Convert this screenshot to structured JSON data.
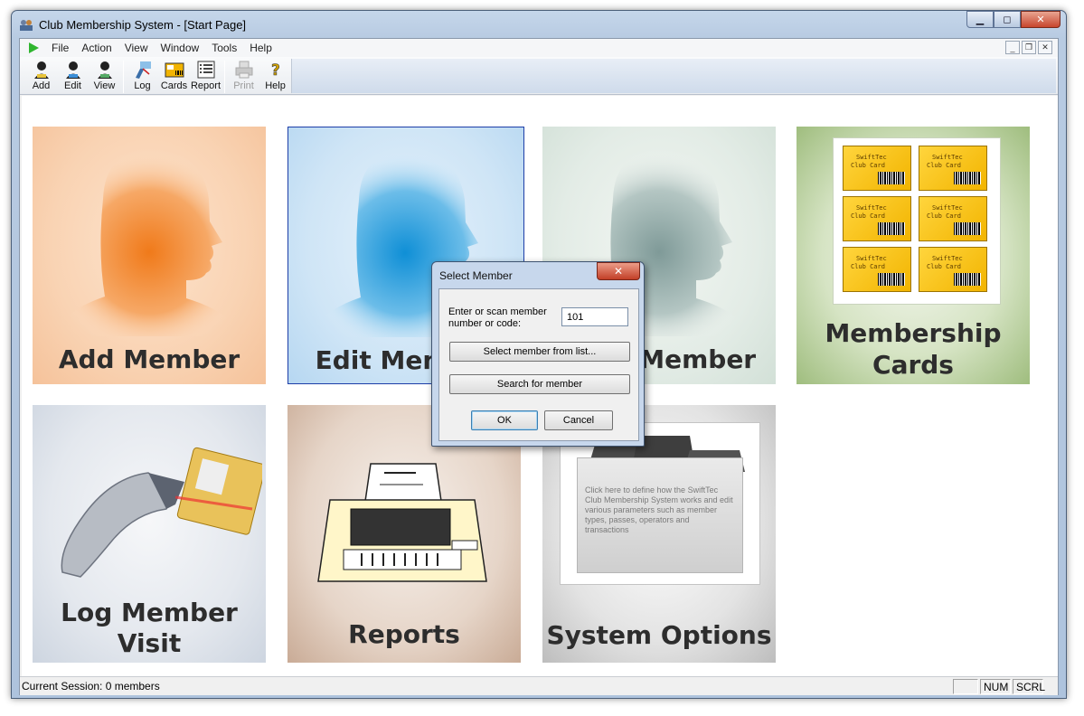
{
  "window": {
    "title": "Club Membership System - [Start Page]",
    "controls": {
      "minimize": "▁",
      "maximize": "◻",
      "close": "✕"
    }
  },
  "menu": {
    "items": [
      "File",
      "Action",
      "View",
      "Window",
      "Tools",
      "Help"
    ],
    "mdi_controls": {
      "minimize": "_",
      "restore": "❐",
      "close": "✕"
    }
  },
  "toolbar": {
    "add": "Add",
    "edit": "Edit",
    "view": "View",
    "log": "Log",
    "cards": "Cards",
    "report": "Report",
    "print": "Print",
    "help": "Help"
  },
  "tiles": {
    "add_member": "Add Member",
    "edit_member": "Edit Member",
    "view_member": "View Member",
    "cards_line1": "Membership",
    "cards_line2": "Cards",
    "card_text_1": "SwiftTec",
    "card_text_2": "Club Card",
    "log_line1": "Log Member",
    "log_line2": "Visit",
    "reports": "Reports",
    "system_options": "System Options",
    "options_desc": "Click here to define how the SwiftTec Club Membership System works and edit various parameters such as member types, passes, operators and transactions"
  },
  "dialog": {
    "title": "Select Member",
    "close": "✕",
    "prompt": "Enter or scan member number or code:",
    "input_value": "101",
    "select_from_list": "Select member from list...",
    "search": "Search for member",
    "ok": "OK",
    "cancel": "Cancel"
  },
  "status": {
    "session": "Current Session: 0 members",
    "num": "NUM",
    "scrl": "SCRL"
  },
  "colors": {
    "add_tile": "#f6b37f",
    "edit_tile": "#4aa8e0",
    "view_tile": "#a9bcb9",
    "cards_tile": "#9bb97a",
    "card_gold": "#f2b400"
  }
}
